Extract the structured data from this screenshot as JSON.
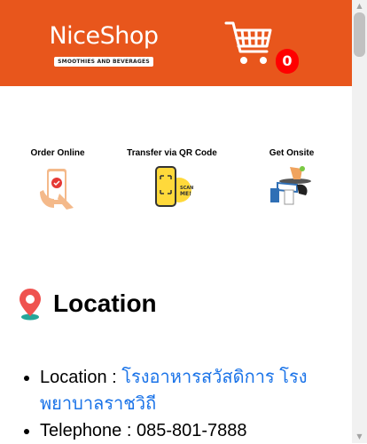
{
  "header": {
    "brand_name": "NiceShop",
    "brand_tagline": "SMOOTHIES AND BEVERAGES",
    "cart_count": "0",
    "background": "#e8561c"
  },
  "steps": [
    {
      "label": "Order Online",
      "icon": "phone-tap-icon"
    },
    {
      "label": "Transfer via QR Code",
      "icon": "qr-phone-icon"
    },
    {
      "label": "Get Onsite",
      "icon": "drink-serving-icon"
    }
  ],
  "location": {
    "heading": "Location",
    "location_label": "Location : ",
    "location_value": "โรงอาหารสวัสดิการ โรงพยาบาลราชวิถี",
    "telephone_label": "Telephone : ",
    "telephone_value": "085-801-7888"
  }
}
